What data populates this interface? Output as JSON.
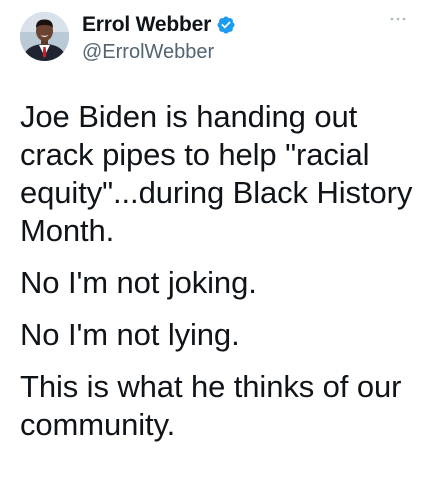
{
  "author": {
    "display_name": "Errol Webber",
    "handle": "@ErrolWebber"
  },
  "tweet": {
    "paragraphs": [
      "Joe Biden is handing out crack pipes to help \"racial equity\"...during Black History Month.",
      "No I'm not joking.",
      "No I'm not lying.",
      "This is what he thinks of our community."
    ]
  },
  "colors": {
    "text": "#0f1419",
    "secondary_text": "#536471",
    "verified_badge": "#1d9bf0"
  },
  "icons": {
    "verified": "verified-badge-icon",
    "more": "more-options-icon"
  }
}
